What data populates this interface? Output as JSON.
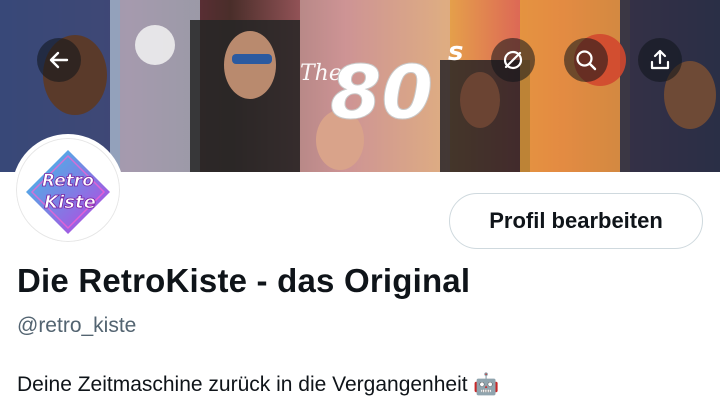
{
  "header": {
    "banner_text": "The 80s",
    "back_button": "back-arrow-icon",
    "actions": [
      "sync-icon",
      "search-icon",
      "share-icon"
    ]
  },
  "profile": {
    "avatar_text_line1": "Retro",
    "avatar_text_line2": "Kiste",
    "edit_button_label": "Profil bearbeiten",
    "display_name": "Die RetroKiste - das Original",
    "handle": "@retro_kiste",
    "bio": "Deine Zeitmaschine zurück in die Vergangenheit 🤖"
  },
  "colors": {
    "text_primary": "#0f1419",
    "text_secondary": "#536471",
    "button_border": "#cfd9de",
    "avatar_gradient_start": "#36c6e8",
    "avatar_gradient_end": "#c23be0"
  }
}
